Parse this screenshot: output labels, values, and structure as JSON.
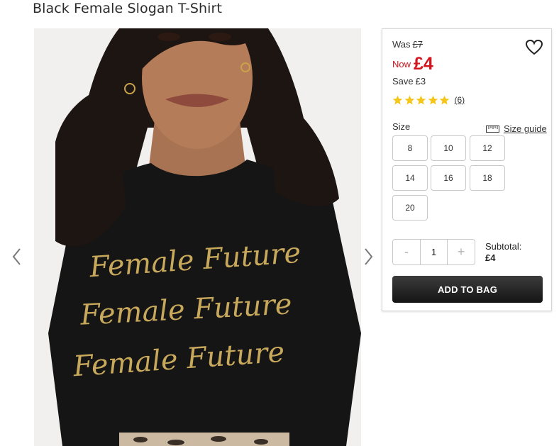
{
  "product": {
    "title": "Black Female Slogan T-Shirt"
  },
  "gallery": {
    "slogan_line": "Female Future",
    "prev_icon": "chevron-left-icon",
    "next_icon": "chevron-right-icon"
  },
  "price": {
    "was_label": "Was",
    "was_value": "£7",
    "now_label": "Now",
    "now_value": "£4",
    "save_label": "Save",
    "save_value": "£3",
    "accent_color": "#d4141c"
  },
  "rating": {
    "stars": 5,
    "count_text": "(6)",
    "star_color": "#f5c518"
  },
  "size": {
    "label": "Size",
    "guide_label": "Size guide",
    "guide_icon": "ruler-icon",
    "options": [
      "8",
      "10",
      "12",
      "14",
      "16",
      "18",
      "20"
    ]
  },
  "quantity": {
    "minus": "-",
    "value": "1",
    "plus": "+"
  },
  "subtotal": {
    "label": "Subtotal:",
    "value": "£4"
  },
  "cta": {
    "add_to_bag": "ADD TO BAG"
  },
  "icons": {
    "wishlist": "heart-icon"
  }
}
